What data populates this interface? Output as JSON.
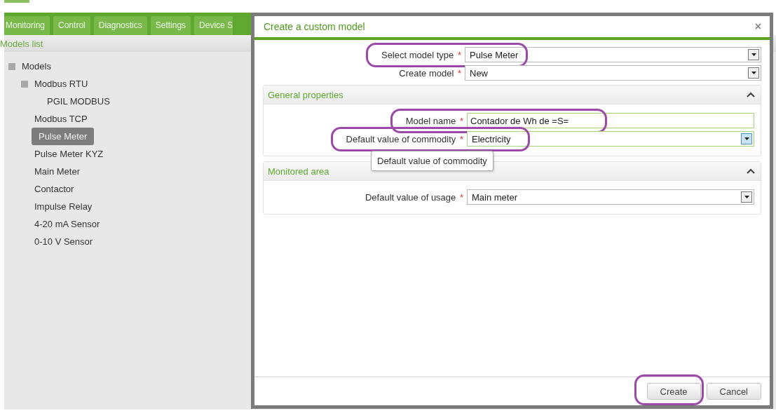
{
  "tabs": [
    {
      "label": "Monitoring"
    },
    {
      "label": "Control"
    },
    {
      "label": "Diagnostics"
    },
    {
      "label": "Settings"
    },
    {
      "label": "Device S"
    }
  ],
  "sidebar": {
    "title": "Models list",
    "tree": [
      {
        "label": "Models",
        "selected": false,
        "children": [
          {
            "label": "Modbus RTU",
            "selected": false,
            "children": [
              {
                "label": "PGIL MODBUS",
                "selected": false
              }
            ]
          },
          {
            "label": "Modbus TCP",
            "selected": false
          },
          {
            "label": "Pulse Meter",
            "selected": true
          },
          {
            "label": "Pulse Meter KYZ",
            "selected": false
          },
          {
            "label": "Main Meter",
            "selected": false
          },
          {
            "label": "Contactor",
            "selected": false
          },
          {
            "label": "Impulse Relay",
            "selected": false
          },
          {
            "label": "4-20 mA Sensor",
            "selected": false
          },
          {
            "label": "0-10 V Sensor",
            "selected": false
          }
        ]
      }
    ]
  },
  "dialog": {
    "title": "Create a custom model",
    "close": "×",
    "fields": [
      {
        "label": "Select model type",
        "marker": "*",
        "kind": "select",
        "value": "Pulse Meter",
        "focused": false,
        "highlighted": true
      },
      {
        "label": "Create model",
        "marker": "*",
        "kind": "select",
        "value": "New",
        "focused": false,
        "highlighted": false
      }
    ],
    "sections": [
      {
        "title": "General properties",
        "expanded": true,
        "fields": [
          {
            "label": "Model name",
            "marker": "*",
            "kind": "text",
            "value": "Contador de Wh de =S=",
            "focused": true,
            "highlighted": true
          },
          {
            "label": "Default value of commodity",
            "marker": "*",
            "kind": "select",
            "value": "Electricity",
            "focused": true,
            "highlighted": true,
            "tooltip": "Default value of commodity"
          }
        ]
      },
      {
        "title": "Monitored area",
        "expanded": true,
        "fields": [
          {
            "label": "Default value of usage",
            "marker": "*",
            "kind": "select",
            "value": "Main meter",
            "focused": false,
            "highlighted": false
          }
        ]
      }
    ],
    "buttons": [
      {
        "label": "Create",
        "highlighted": true
      },
      {
        "label": "Cancel",
        "highlighted": false
      }
    ]
  }
}
